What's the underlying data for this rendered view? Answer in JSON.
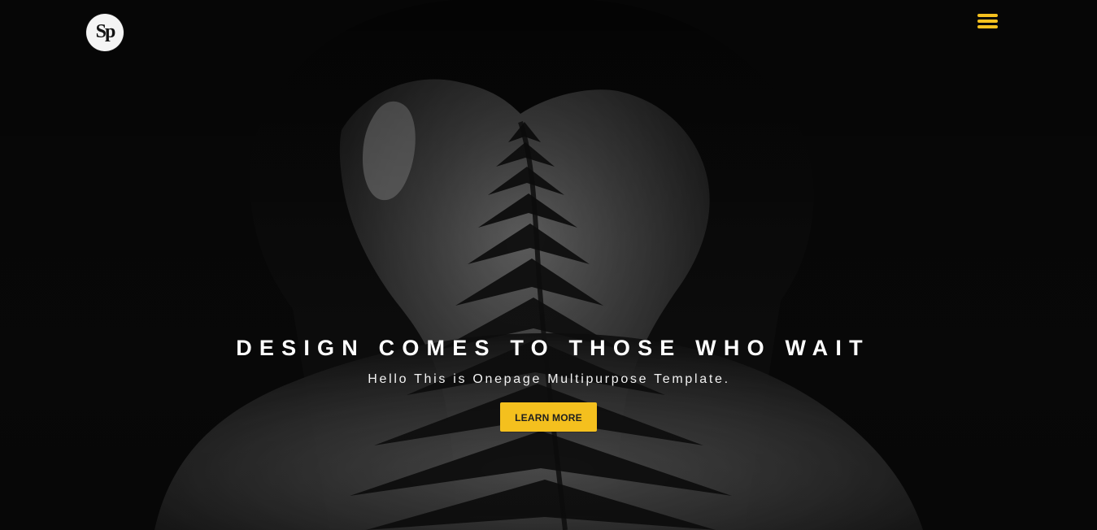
{
  "branding": {
    "logo_text": "Sp"
  },
  "header": {
    "menu_icon_name": "hamburger-icon"
  },
  "hero": {
    "title": "DESIGN COMES TO THOSE WHO WAIT",
    "subtitle": "Hello This is Onepage Multipurpose Template.",
    "button_label": "LEARN MORE"
  },
  "colors": {
    "accent": "#f4c01e",
    "background": "#0b0b0b",
    "text": "#ffffff",
    "logo_background": "#f4f4f4"
  }
}
